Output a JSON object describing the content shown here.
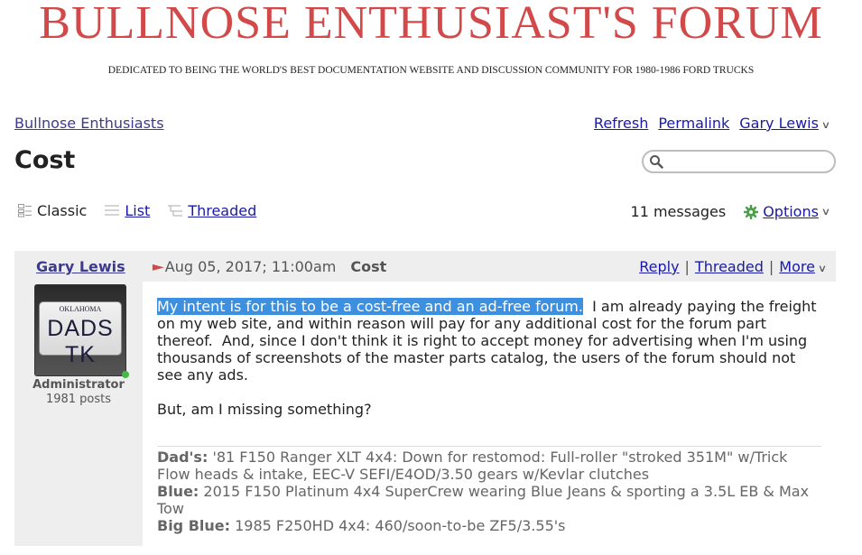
{
  "banner": {
    "title": "BULLNOSE ENTHUSIAST'S FORUM",
    "subtitle": "DEDICATED TO BEING THE WORLD'S BEST DOCUMENTATION WEBSITE AND DISCUSSION COMMUNITY FOR 1980-1986 FORD TRUCKS"
  },
  "breadcrumb": "Bullnose Enthusiasts",
  "top_links": {
    "refresh": "Refresh",
    "permalink": "Permalink",
    "user": "Gary Lewis"
  },
  "page_title": "Cost",
  "search": {
    "placeholder": "",
    "value": ""
  },
  "views": {
    "classic": "Classic",
    "list": "List",
    "threaded": "Threaded"
  },
  "message_count": "11 messages",
  "options_label": "Options",
  "post": {
    "author": "Gary Lewis",
    "date": "Aug 05, 2017; 11:00am",
    "subject": "Cost",
    "actions": {
      "reply": "Reply",
      "threaded": "Threaded",
      "more": "More"
    },
    "author_role": "Administrator",
    "author_posts": "1981 posts",
    "avatar_plate": {
      "state": "OKLAHOMA",
      "text": "DADS TK"
    },
    "highlighted": "My intent is for this to be a cost-free and an ad-free forum.",
    "body_rest": "  I am already paying the freight on my web site, and within reason will pay for any additional cost for the forum part thereof.  And, since I don't think it is right to accept money for advertising when I'm using thousands of screenshots of the master parts catalog, the users of the forum should not see any ads.",
    "body_p2": "But, am I missing something?",
    "signature": [
      {
        "label": "Dad's:",
        "text": " '81 F150 Ranger XLT 4x4: Down for restomod: Full-roller \"stroked 351M\" w/Trick Flow heads & intake, EEC-V SEFI/E4OD/3.50 gears w/Kevlar clutches"
      },
      {
        "label": "Blue:",
        "text": " 2015 F150 Platinum 4x4 SuperCrew wearing Blue Jeans & sporting a 3.5L EB & Max Tow"
      },
      {
        "label": "Big Blue:",
        "text": " 1985 F250HD 4x4: 460/soon-to-be ZF5/3.55's"
      }
    ]
  },
  "colors": {
    "banner_red": "#d2494a",
    "link_blue": "#1a1aa6",
    "panel_gray": "#eeeeee",
    "selection_blue": "#3d8fe0",
    "online_green": "#44bb44"
  },
  "icons": [
    "search-icon",
    "classic-view-icon",
    "list-view-icon",
    "threaded-view-icon",
    "gear-icon",
    "chevron-down-icon",
    "red-flag-icon"
  ]
}
